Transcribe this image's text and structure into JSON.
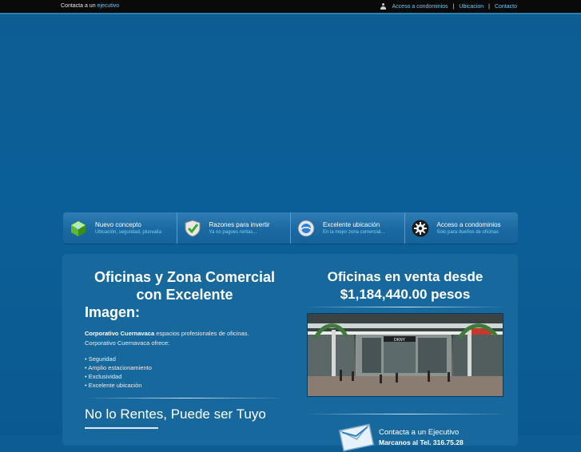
{
  "topbar": {
    "contact_prefix": "Contacta a un",
    "contact_link": "ejecutivo",
    "links": [
      "Acceso a condominios",
      "Ubicacion",
      "Contacto"
    ],
    "separator": "|"
  },
  "nav": [
    {
      "title": "Nuevo concepto",
      "subtitle": "Ubicación, seguridad, plusvalía",
      "icon": "cube-icon"
    },
    {
      "title": "Razones para invertir",
      "subtitle": "Ya no pagues rentas...",
      "icon": "shield-check-icon"
    },
    {
      "title": "Excelente ubicación",
      "subtitle": "En la mejor zona comercial...",
      "icon": "location-icon"
    },
    {
      "title": "Acceso a condominios",
      "subtitle": "Solo para dueños de oficinas",
      "icon": "gear-icon"
    }
  ],
  "left": {
    "heading_line1": "Oficinas y Zona Comercial",
    "heading_line2": "con Excelente",
    "heading_line3": "Imagen:",
    "intro_bold": "Corporativo Cuernavaca",
    "intro_rest": " espacios profesionales de oficinas.",
    "intro_line2": "Corporativo Cuernavaca ofrece:",
    "bullets": [
      "• Seguridad",
      "• Amplio estacionamiento",
      "• Exclusividad",
      "• Excelente ubicación"
    ],
    "slogan": "No lo Rentes, Puede ser Tuyo"
  },
  "right": {
    "heading_line1": "Oficinas en venta desde",
    "heading_line2": "$1,184,440.00 pesos",
    "photo_sign": "DKNY",
    "contact_title": "Contacta a un Ejecutivo",
    "contact_phone": "Marcanos al Tel. 316.75.28"
  }
}
